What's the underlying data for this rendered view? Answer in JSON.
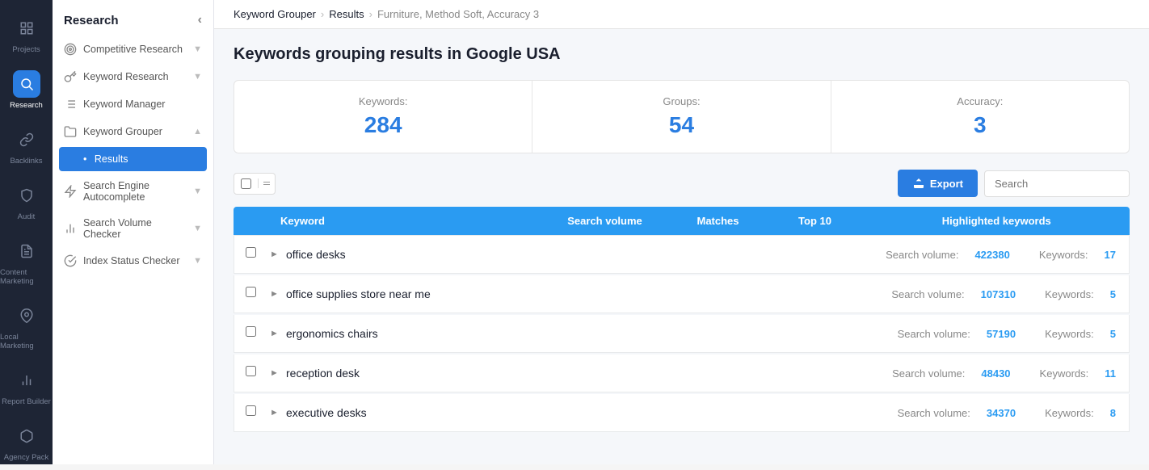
{
  "app": {
    "title": "Research"
  },
  "left_nav": {
    "items": [
      {
        "id": "projects",
        "label": "Projects",
        "icon": "grid"
      },
      {
        "id": "research",
        "label": "Research",
        "icon": "search",
        "active": true
      },
      {
        "id": "backlinks",
        "label": "Backlinks",
        "icon": "link"
      },
      {
        "id": "audit",
        "label": "Audit",
        "icon": "shield"
      },
      {
        "id": "content-marketing",
        "label": "Content Marketing",
        "icon": "file-text"
      },
      {
        "id": "local-marketing",
        "label": "Local Marketing",
        "icon": "map-pin"
      },
      {
        "id": "report-builder",
        "label": "Report Builder",
        "icon": "bar-chart"
      },
      {
        "id": "agency-pack",
        "label": "Agency Pack",
        "icon": "package"
      }
    ]
  },
  "middle_sidebar": {
    "title": "Research",
    "items": [
      {
        "id": "competitive-research",
        "label": "Competitive Research",
        "icon": "target",
        "has_children": true
      },
      {
        "id": "keyword-research",
        "label": "Keyword Research",
        "icon": "key",
        "has_children": true
      },
      {
        "id": "keyword-manager",
        "label": "Keyword Manager",
        "icon": "list"
      },
      {
        "id": "keyword-grouper",
        "label": "Keyword Grouper",
        "icon": "folder",
        "has_children": true,
        "expanded": true,
        "children": [
          {
            "id": "results",
            "label": "Results",
            "active": true
          }
        ]
      },
      {
        "id": "search-engine-autocomplete",
        "label": "Search Engine Autocomplete",
        "icon": "zap",
        "has_children": true
      },
      {
        "id": "search-volume-checker",
        "label": "Search Volume Checker",
        "icon": "bar-chart-2",
        "has_children": true
      },
      {
        "id": "index-status-checker",
        "label": "Index Status Checker",
        "icon": "check-circle",
        "has_children": true
      }
    ]
  },
  "breadcrumb": {
    "items": [
      {
        "label": "Keyword Grouper",
        "link": true
      },
      {
        "label": "Results",
        "link": true
      },
      {
        "label": "Furniture, Method Soft, Accuracy 3",
        "link": false
      }
    ]
  },
  "page": {
    "title": "Keywords grouping results in Google USA",
    "stats": {
      "keywords_label": "Keywords:",
      "keywords_value": "284",
      "groups_label": "Groups:",
      "groups_value": "54",
      "accuracy_label": "Accuracy:",
      "accuracy_value": "3"
    },
    "toolbar": {
      "export_label": "Export",
      "search_placeholder": "Search"
    },
    "table": {
      "columns": [
        {
          "id": "checkbox",
          "label": ""
        },
        {
          "id": "keyword",
          "label": "Keyword"
        },
        {
          "id": "search_volume",
          "label": "Search volume"
        },
        {
          "id": "matches",
          "label": "Matches"
        },
        {
          "id": "top10",
          "label": "Top 10"
        },
        {
          "id": "highlighted",
          "label": "Highlighted keywords"
        }
      ],
      "rows": [
        {
          "keyword": "office desks",
          "search_volume_label": "Search volume:",
          "search_volume": "422380",
          "keywords_label": "Keywords:",
          "keywords_count": "17"
        },
        {
          "keyword": "office supplies store near me",
          "search_volume_label": "Search volume:",
          "search_volume": "107310",
          "keywords_label": "Keywords:",
          "keywords_count": "5"
        },
        {
          "keyword": "ergonomics chairs",
          "search_volume_label": "Search volume:",
          "search_volume": "57190",
          "keywords_label": "Keywords:",
          "keywords_count": "5"
        },
        {
          "keyword": "reception desk",
          "search_volume_label": "Search volume:",
          "search_volume": "48430",
          "keywords_label": "Keywords:",
          "keywords_count": "11"
        },
        {
          "keyword": "executive desks",
          "search_volume_label": "Search volume:",
          "search_volume": "34370",
          "keywords_label": "Keywords:",
          "keywords_count": "8"
        }
      ]
    }
  }
}
